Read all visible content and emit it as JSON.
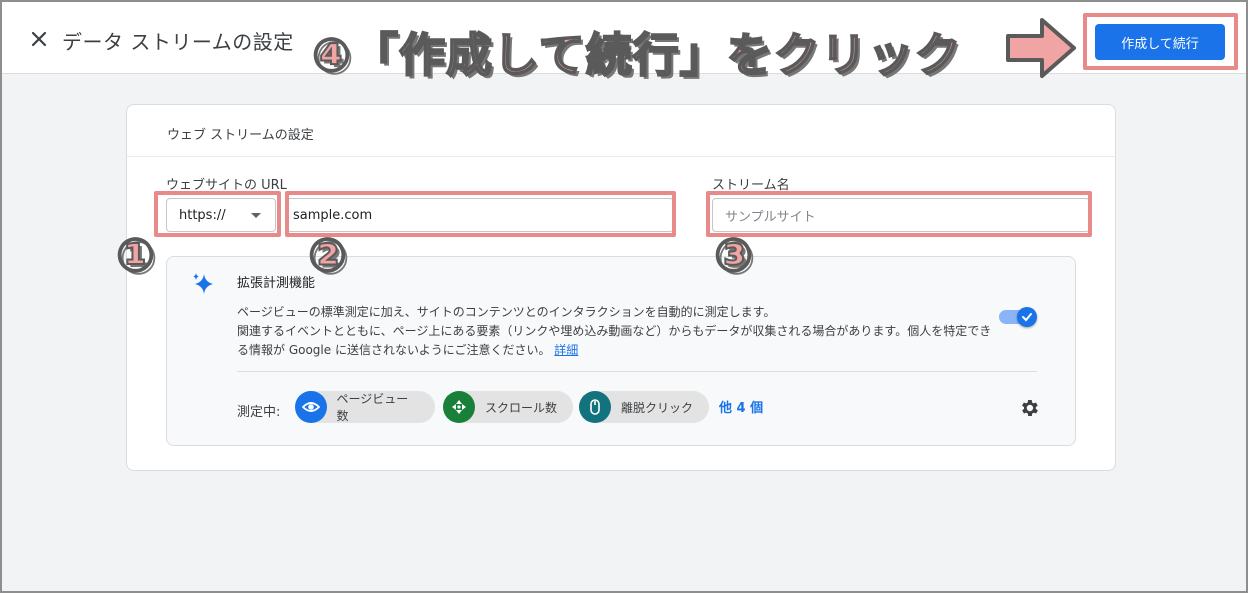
{
  "header": {
    "title": "データ ストリームの設定",
    "primary_button": "作成して続行"
  },
  "card": {
    "title": "ウェブ ストリームの設定",
    "url_label": "ウェブサイトの URL",
    "protocol_value": "https://",
    "url_value": "sample.com",
    "stream_name_label": "ストリーム名",
    "stream_name_placeholder": "サンプルサイト"
  },
  "enhanced": {
    "title": "拡張計測機能",
    "desc_line1": "ページビューの標準測定に加え、サイトのコンテンツとのインタラクションを自動的に測定します。",
    "desc_line2": "関連するイベントとともに、ページ上にある要素（リンクや埋め込み動画など）からもデータが収集される場合があります。個人を特定でき",
    "desc_line3": "る情報が Google に送信されないようにご注意ください。",
    "details_link": "詳細",
    "toggle_on": true,
    "measuring_label": "測定中:",
    "chips": [
      {
        "label": "ページビュー数",
        "icon": "eye-icon",
        "color": "#1a73e8"
      },
      {
        "label": "スクロール数",
        "icon": "scroll-icon",
        "color": "#188038"
      },
      {
        "label": "離脱クリック",
        "icon": "mouse-icon",
        "color": "#12737e"
      }
    ],
    "more_link": "他 4 個"
  },
  "annotations": {
    "headline": "④「作成して続行」をクリック",
    "n1": "①",
    "n2": "②",
    "n3": "③",
    "highlight_color": "#e88a8a"
  }
}
